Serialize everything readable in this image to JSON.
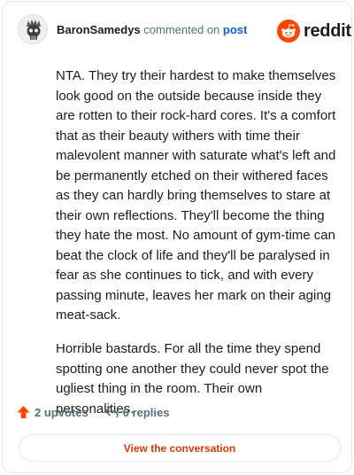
{
  "header": {
    "username": "BaronSamedys",
    "action_text": "commented on",
    "post_link": "post",
    "brand_name": "reddit",
    "avatar_icon": "skull-avatar-icon",
    "brand_icon": "reddit-alien-icon"
  },
  "comment": {
    "paragraphs": [
      "NTA. They try their hardest to make themselves look good on the outside because inside they are rotten to their rock-hard cores. It's a comfort that as their beauty withers with time their malevolent manner with saturate what's left and be permanently etched on their withered faces as they can hardly bring themselves to stare at their own reflections. They'll become the thing they hate the most. No amount of gym-time can beat the clock of life and they'll be paralysed in fear as she continues to tick, and with every passing minute, leaves her mark on their aging meat-sack.",
      "Horrible bastards. For all the time they spend spotting one another they could never spot the ugliest thing in the room. Their own personalities."
    ]
  },
  "footer": {
    "upvotes_label": "2 upvotes",
    "replies_label": "0 replies",
    "upvote_icon": "upvote-arrow-icon",
    "reply_icon": "reply-arrow-icon",
    "cta_label": "View the conversation"
  },
  "colors": {
    "brand_orange": "#ff4500",
    "link_blue": "#0a63ca",
    "cta_text": "#d93900",
    "muted_text": "#576f76"
  }
}
